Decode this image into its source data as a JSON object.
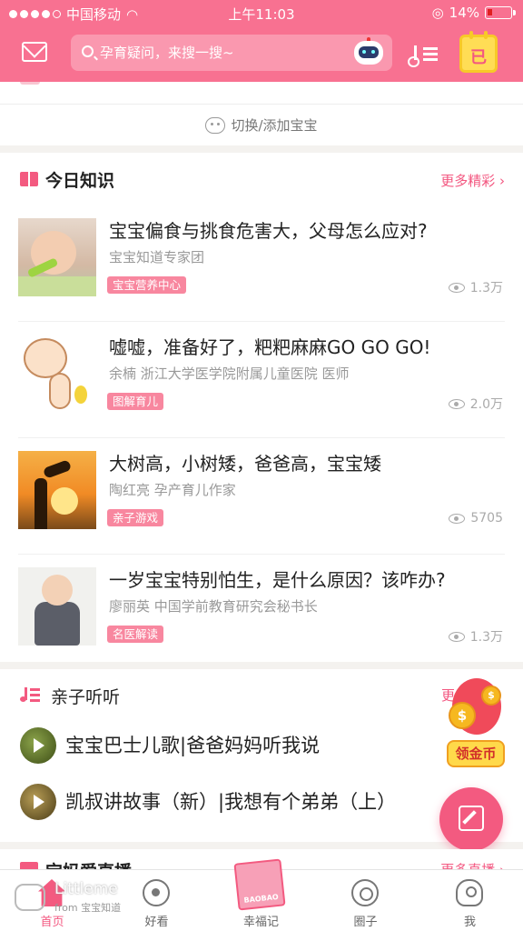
{
  "status_bar": {
    "carrier": "中国移动",
    "time": "上午11:03",
    "battery": "14%"
  },
  "header": {
    "search_placeholder": "孕育疑问，来搜一搜~",
    "checkin_label": "已",
    "icons": [
      "mail-icon",
      "search-icon",
      "robot-assistant-icon",
      "music-list-icon",
      "calendar-checkin-icon"
    ],
    "accent_color": "#f87191"
  },
  "baby_switch": {
    "label": "切换/添加宝宝"
  },
  "knowledge": {
    "title": "今日知识",
    "more": "更多精彩",
    "articles": [
      {
        "title": "宝宝偏食与挑食危害大，父母怎么应对?",
        "author": "宝宝知道专家团",
        "tag": "宝宝营养中心",
        "views": "1.3万"
      },
      {
        "title": "嘘嘘，准备好了，粑粑麻麻GO GO GO!",
        "author": "余楠  浙江大学医学院附属儿童医院 医师",
        "tag": "图解育儿",
        "views": "2.0万"
      },
      {
        "title": "大树高，小树矮，爸爸高，宝宝矮",
        "author": "陶红亮  孕产育儿作家",
        "tag": "亲子游戏",
        "views": "5705"
      },
      {
        "title": "一岁宝宝特别怕生，是什么原因？该咋办?",
        "author": "廖丽英  中国学前教育研究会秘书长",
        "tag": "名医解读",
        "views": "1.3万"
      }
    ]
  },
  "listen": {
    "title": "亲子听听",
    "more": "更",
    "items": [
      {
        "title": "宝宝巴士儿歌|爸爸妈妈听我说"
      },
      {
        "title": "凯叔讲故事（新）|我想有个弟弟（上）"
      }
    ]
  },
  "next_section": {
    "title": "宝妈爱直播",
    "more": "更多直播"
  },
  "coin_widget": {
    "label": "领金币",
    "coin_symbol": "$"
  },
  "tabbar": {
    "items": [
      {
        "label": "首页",
        "icon": "home-icon",
        "active": true
      },
      {
        "label": "好看",
        "icon": "eye-icon",
        "active": false
      },
      {
        "label": "幸福记",
        "icon": "diary-book-icon",
        "active": false
      },
      {
        "label": "圈子",
        "icon": "circle-icon",
        "active": false
      },
      {
        "label": "我",
        "icon": "profile-icon",
        "active": false
      }
    ],
    "book_text": "BAOBAO"
  },
  "watermark": {
    "line1": "Littleme",
    "line2": "from 宝宝知道"
  }
}
